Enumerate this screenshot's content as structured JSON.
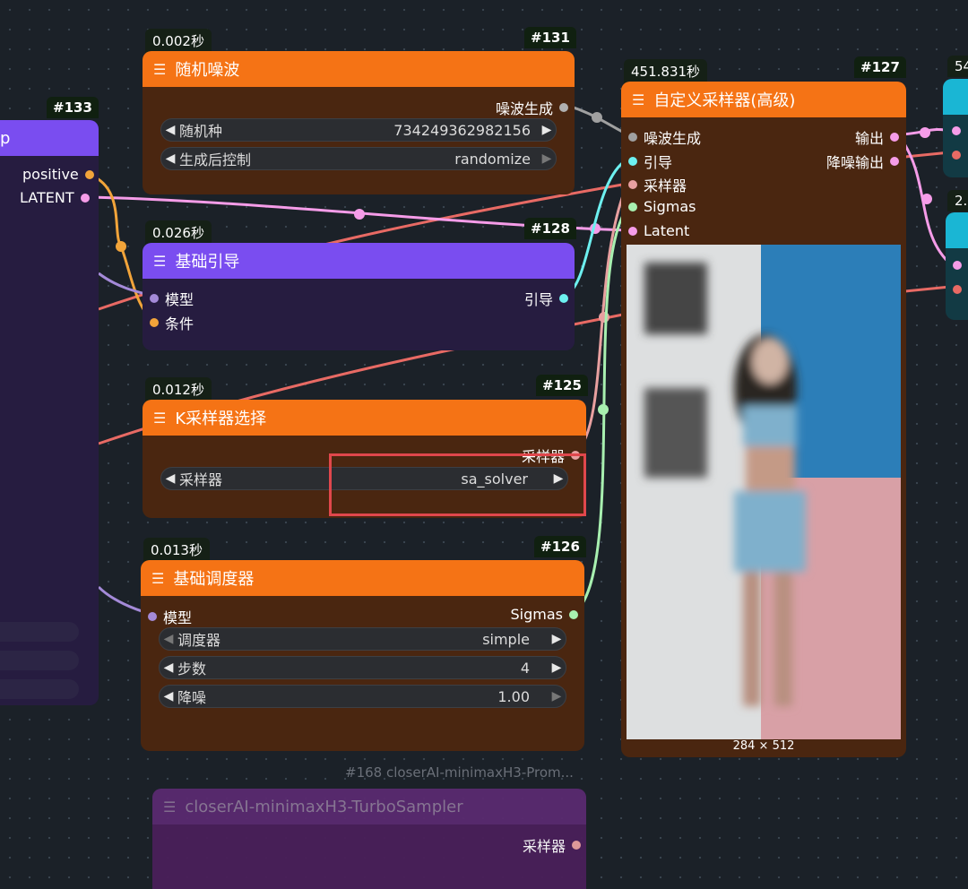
{
  "nodes": {
    "n133": {
      "id": "#133",
      "title_fragment": "p",
      "outputs": [
        "positive",
        "LATENT"
      ]
    },
    "noise": {
      "timing": "0.002秒",
      "id": "#131",
      "title": "随机噪波",
      "output": "噪波生成",
      "widgets": [
        {
          "label": "随机种",
          "value": "734249362982156"
        },
        {
          "label": "生成后控制",
          "value": "randomize"
        }
      ]
    },
    "guider": {
      "timing": "0.026秒",
      "id": "#128",
      "title": "基础引导",
      "inputs": [
        "模型",
        "条件"
      ],
      "output": "引导"
    },
    "ksampler_select": {
      "timing": "0.012秒",
      "id": "#125",
      "title": "K采样器选择",
      "output": "采样器",
      "widget": {
        "label": "采样器",
        "value": "sa_solver"
      }
    },
    "scheduler": {
      "timing": "0.013秒",
      "id": "#126",
      "title": "基础调度器",
      "input": "模型",
      "output": "Sigmas",
      "widgets": [
        {
          "label": "调度器",
          "value": "simple"
        },
        {
          "label": "步数",
          "value": "4"
        },
        {
          "label": "降噪",
          "value": "1.00"
        }
      ]
    },
    "custom_sampler": {
      "timing": "451.831秒",
      "id": "#127",
      "title": "自定义采样器(高级)",
      "inputs": [
        "噪波生成",
        "引导",
        "采样器",
        "Sigmas",
        "Latent"
      ],
      "outputs": [
        "输出",
        "降噪输出"
      ],
      "image_size": "284 × 512"
    },
    "minimax": {
      "label": "#168 closerAI-minimaxH3-Prom...",
      "title": "closerAI-minimaxH3-TurboSampler",
      "output": "采样器"
    },
    "right_partial": {
      "timing1": "54",
      "timing2": "2."
    }
  },
  "colors": {
    "orange_head": "#f57315",
    "purple_head": "#7a4df0",
    "cyan_head": "#1ab6d4",
    "highlight": "#e0474c",
    "wire_pink": "#f59ce8",
    "wire_green": "#a8f0b0",
    "wire_cyan": "#6df0f0",
    "wire_red": "#e86a64",
    "wire_orange": "#f2a43a",
    "wire_purple": "#a48ad8"
  }
}
